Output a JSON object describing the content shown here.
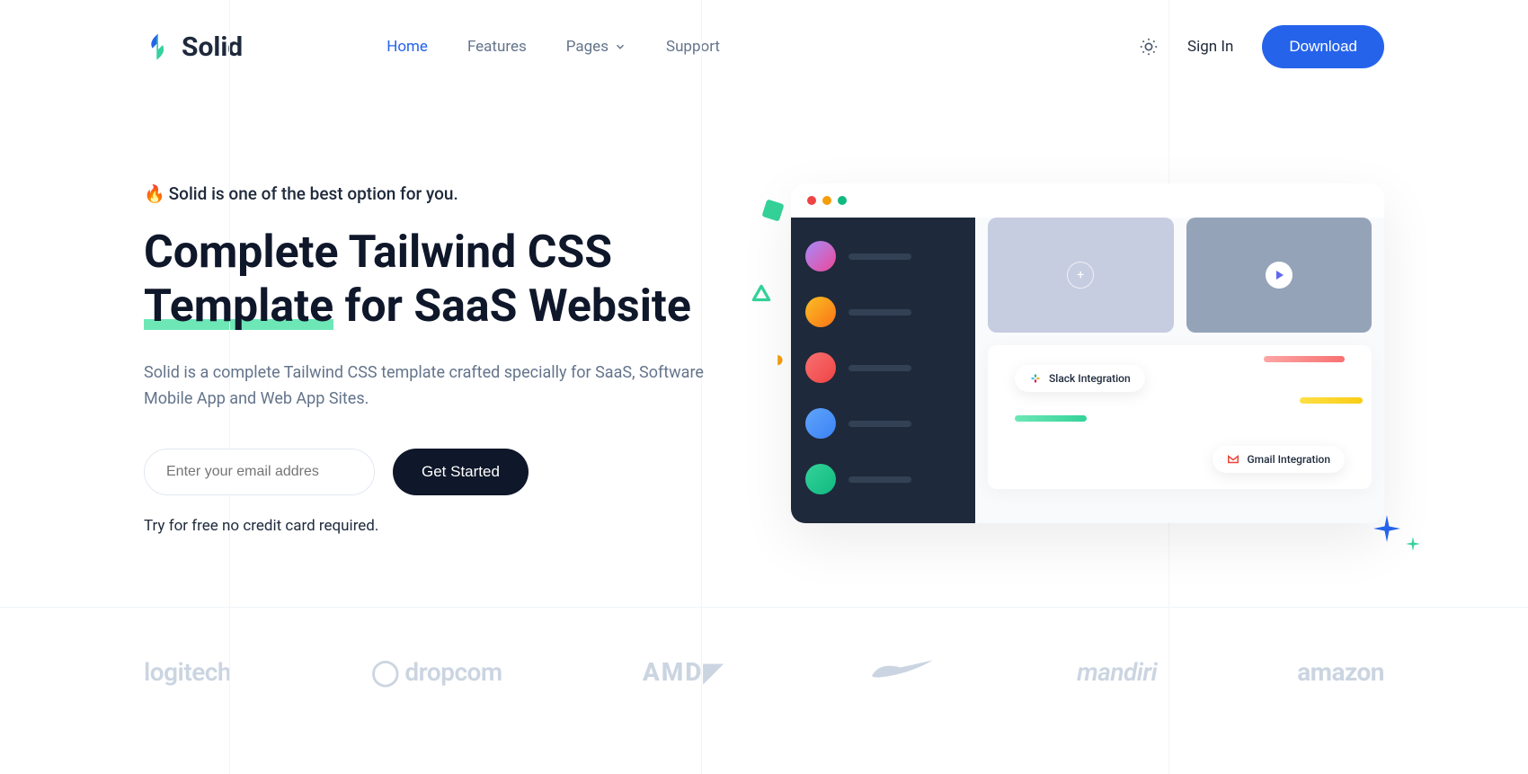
{
  "brand": {
    "name": "Solid"
  },
  "nav": {
    "items": [
      {
        "label": "Home",
        "active": true
      },
      {
        "label": "Features",
        "active": false
      },
      {
        "label": "Pages",
        "active": false,
        "dropdown": true
      },
      {
        "label": "Support",
        "active": false
      }
    ],
    "signin": "Sign In",
    "download": "Download"
  },
  "hero": {
    "tagline_emoji": "🔥",
    "tagline": "Solid is one of the best option for you.",
    "title_line1": "Complete Tailwind CSS",
    "title_highlight": "Template",
    "title_after": " for SaaS Website",
    "description": "Solid is a complete Tailwind CSS template crafted specially for SaaS, Software Mobile App and Web App Sites.",
    "email_placeholder": "Enter your email addres",
    "cta": "Get Started",
    "trial_note": "Try for free no credit card required."
  },
  "mockup": {
    "integrations": {
      "slack": "Slack Integration",
      "gmail": "Gmail Integration"
    }
  },
  "brands": [
    "logitech",
    "dropcom",
    "AMD",
    "nike",
    "mandiri",
    "amazon"
  ]
}
